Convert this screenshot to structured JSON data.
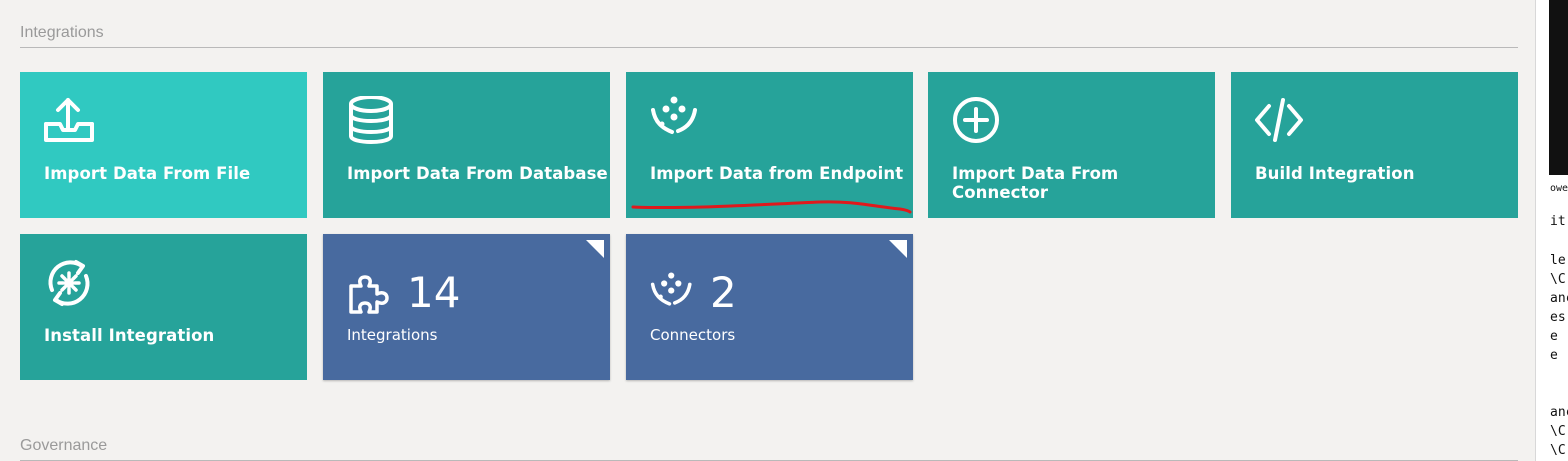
{
  "sections": {
    "integrations": "Integrations",
    "governance": "Governance"
  },
  "tiles": [
    {
      "label": "Import Data From File",
      "icon": "upload-tray-icon"
    },
    {
      "label": "Import Data From Database",
      "icon": "database-icon"
    },
    {
      "label": "Import Data from Endpoint",
      "icon": "endpoint-dots-icon"
    },
    {
      "label": "Import Data From Connector",
      "icon": "plus-circle-icon"
    },
    {
      "label": "Build Integration",
      "icon": "code-brackets-icon"
    },
    {
      "label": "Install Integration",
      "icon": "refresh-gear-icon"
    }
  ],
  "stats": [
    {
      "count": "14",
      "label": "Integrations",
      "icon": "puzzle-piece-icon"
    },
    {
      "count": "2",
      "label": "Connectors",
      "icon": "endpoint-dots-icon"
    }
  ],
  "colors": {
    "teal": "#26a39a",
    "light_teal": "#30c9c1",
    "blue": "#486a9f",
    "annotation": "#e0191c"
  },
  "terminal": {
    "lines": [
      "owe",
      "it",
      "le",
      "\\C",
      "anc",
      "es",
      "e",
      "e",
      "anc",
      "\\C",
      "\\C"
    ]
  }
}
